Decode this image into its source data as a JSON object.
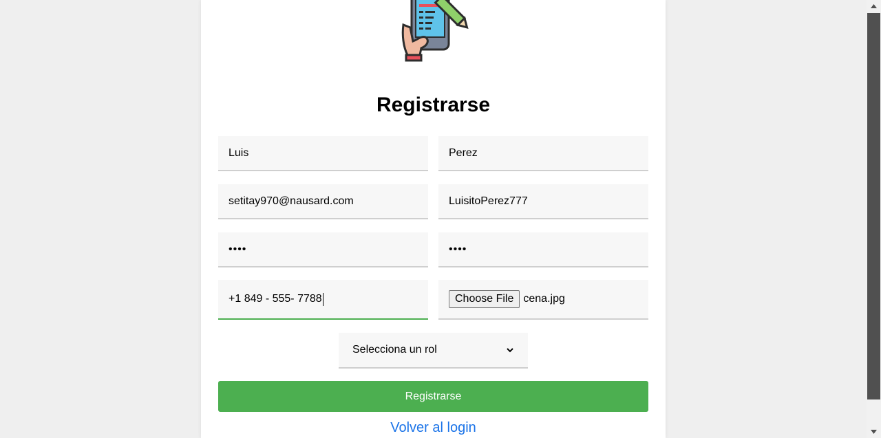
{
  "form": {
    "title": "Registrarse",
    "first_name": "Luis",
    "last_name": "Perez",
    "email": "setitay970@nausard.com",
    "username": "LuisitoPerez777",
    "password": "••••",
    "confirm_password": "••••",
    "phone": "+1 849 - 555- 7788",
    "file_button_label": "Choose File",
    "file_name": "cena.jpg",
    "role_select": "Selecciona un rol",
    "submit_label": "Registrarse",
    "back_link": "Volver al login"
  },
  "colors": {
    "accent": "#4caf50",
    "link": "#1a73e8"
  },
  "icons": {
    "logo": "phone-edit-icon",
    "select": "chevron-down-icon"
  }
}
